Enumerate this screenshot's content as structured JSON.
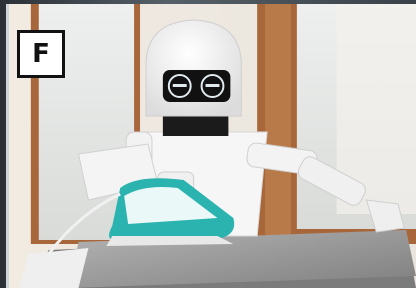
{
  "panel": {
    "letter": "F"
  },
  "colors": {
    "iron_accent": "#2bb3b0",
    "robot_body": "#f7f7f7",
    "window_frame": "#a8673b",
    "ironing_cloth": "#9a9a9a"
  }
}
